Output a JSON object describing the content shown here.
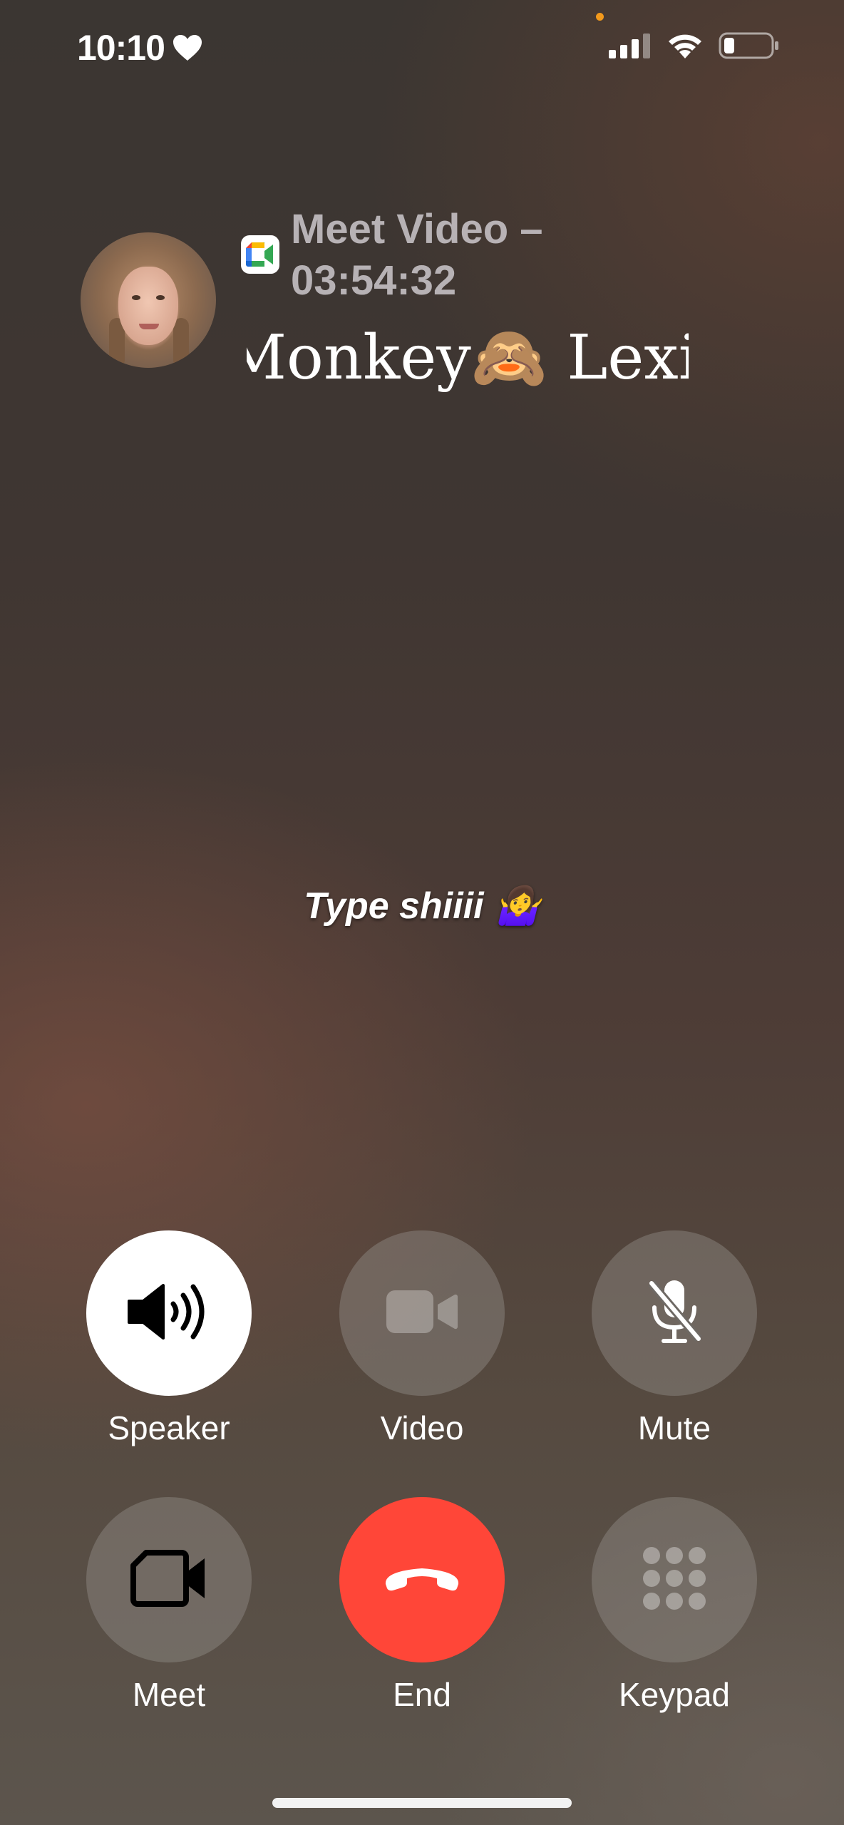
{
  "status_bar": {
    "time": "10:10",
    "icons": [
      "heart-icon",
      "cellular-signal-icon",
      "wifi-icon",
      "battery-icon"
    ],
    "battery_level": 0.2,
    "mic_in_use_color": "#f2991c"
  },
  "call": {
    "app_icon": "google-meet-icon",
    "info_line1": "Meet Video –",
    "info_line2": "03:54:32",
    "caller_name": "Monkey🙈 Lexi",
    "caption": "Type shiiii 🤷‍♀️"
  },
  "controls": {
    "speaker": {
      "label": "Speaker",
      "icon": "speaker-icon",
      "active": true
    },
    "video": {
      "label": "Video",
      "icon": "video-camera-icon",
      "active": false
    },
    "mute": {
      "label": "Mute",
      "icon": "microphone-slash-icon",
      "active": false
    },
    "meet": {
      "label": "Meet",
      "icon": "meet-camera-icon",
      "active": false
    },
    "end": {
      "label": "End",
      "icon": "end-call-icon",
      "color": "#ff4638"
    },
    "keypad": {
      "label": "Keypad",
      "icon": "keypad-icon",
      "active": false
    }
  }
}
